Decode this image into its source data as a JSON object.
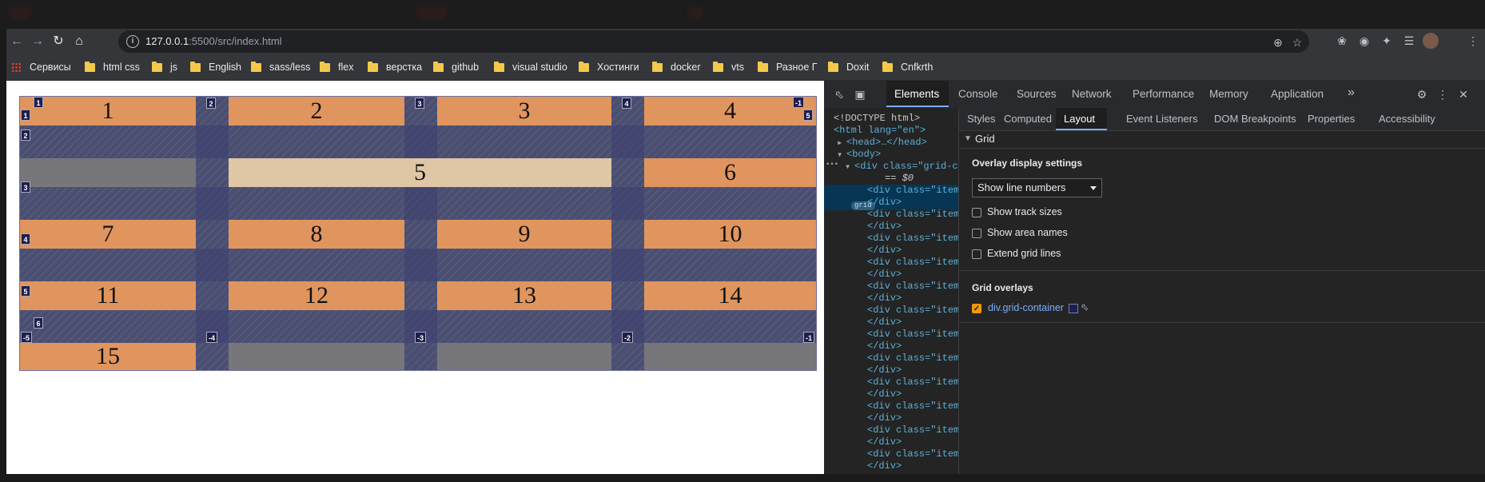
{
  "browser": {
    "url_host": "127.0.0.1",
    "url_rest": ":5500/src/index.html"
  },
  "bookmarks": [
    {
      "label": "Сервисы",
      "icon": "apps-icon"
    },
    {
      "label": "html css",
      "icon": "folder-icon"
    },
    {
      "label": "js",
      "icon": "folder-icon"
    },
    {
      "label": "English",
      "icon": "folder-icon"
    },
    {
      "label": "sass/less",
      "icon": "folder-icon"
    },
    {
      "label": "flex",
      "icon": "folder-icon"
    },
    {
      "label": "верстка",
      "icon": "folder-icon"
    },
    {
      "label": "github",
      "icon": "folder-icon"
    },
    {
      "label": "visual studio",
      "icon": "folder-icon"
    },
    {
      "label": "Хостинги",
      "icon": "folder-icon"
    },
    {
      "label": "docker",
      "icon": "folder-icon"
    },
    {
      "label": "vts",
      "icon": "folder-icon"
    },
    {
      "label": "Разное Г",
      "icon": "folder-icon"
    },
    {
      "label": "Doxit",
      "icon": "folder-icon"
    },
    {
      "label": "Cnfkrth",
      "icon": "folder-icon"
    }
  ],
  "grid_items": [
    "1",
    "2",
    "3",
    "4",
    "5",
    "6",
    "7",
    "8",
    "9",
    "10",
    "11",
    "12",
    "13",
    "14",
    "15"
  ],
  "grid_line_labels": {
    "top": [
      "1",
      "2",
      "3",
      "4",
      "-1"
    ],
    "left": [
      "1",
      "2",
      "3",
      "4",
      "5",
      "6"
    ],
    "right": [
      "5"
    ],
    "bottom": [
      "-5",
      "-4",
      "-3",
      "-2",
      "-1"
    ]
  },
  "devtools": {
    "tabs": [
      "Elements",
      "Console",
      "Sources",
      "Network",
      "Performance",
      "Memory",
      "Application"
    ],
    "more": "»",
    "dom_lines": {
      "doctype": "<!DOCTYPE html>",
      "html_open": "<html lang=\"en\">",
      "head": "<head>…</head>",
      "body": "<body>",
      "div_grid": "<div class=\"grid-c",
      "badge": "grid",
      "eq": "== $0",
      "item_open": "<div class=\"item",
      "div_close": "</div>",
      "dots": "•••"
    },
    "subtabs": [
      "Styles",
      "Computed",
      "Layout",
      "Event Listeners",
      "DOM Breakpoints",
      "Properties",
      "Accessibility"
    ],
    "grid_section": "Grid",
    "overlay_title": "Overlay display settings",
    "select_value": "Show line numbers",
    "checkboxes": [
      "Show track sizes",
      "Show area names",
      "Extend grid lines"
    ],
    "overlays_title": "Grid overlays",
    "overlay_item": "div.grid-container"
  }
}
